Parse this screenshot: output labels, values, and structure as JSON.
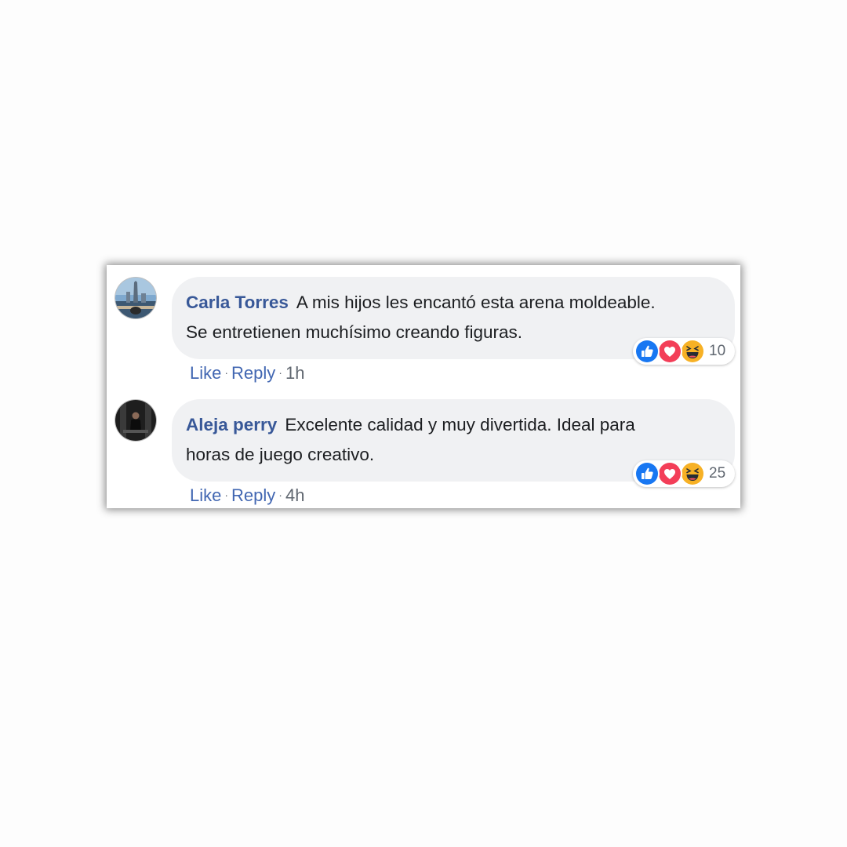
{
  "comments": [
    {
      "author": "Carla Torres",
      "text_line1": "A mis hijos les encantó esta arena moldeable.",
      "text_line2": "Se entretienen muchísimo creando figuras.",
      "actions": {
        "like": "Like",
        "reply": "Reply",
        "separator": "·",
        "time": "1h"
      },
      "reactions": {
        "icons": [
          "like-icon",
          "love-icon",
          "haha-icon"
        ],
        "count": "10"
      }
    },
    {
      "author": "Aleja perry",
      "text_line1": "Excelente calidad y muy divertida. Ideal para",
      "text_line2": "horas de juego creativo.",
      "actions": {
        "like": "Like",
        "reply": "Reply",
        "separator": "·",
        "time": "4h"
      },
      "reactions": {
        "icons": [
          "like-icon",
          "love-icon",
          "haha-icon"
        ],
        "count": "25"
      }
    }
  ],
  "colors": {
    "author": "#385898",
    "action_link": "#4267b2",
    "muted": "#606770",
    "bubble": "#f0f1f3",
    "like": "#1877f2",
    "love": "#f33e58",
    "haha": "#f7b125"
  }
}
